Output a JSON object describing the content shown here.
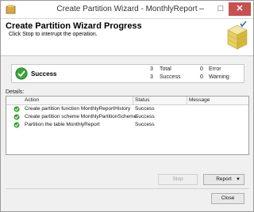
{
  "window": {
    "title": "Create Partition Wizard - MonthlyReport",
    "minimize": "–",
    "maximize": "□",
    "close": "✕"
  },
  "header": {
    "title": "Create Partition Wizard Progress",
    "subtitle": "Click Stop to interrupt the operation."
  },
  "summary": {
    "status": "Success",
    "total_count": "3",
    "total_label": "Total",
    "success_count": "3",
    "success_label": "Success",
    "error_count": "0",
    "error_label": "Error",
    "warning_count": "0",
    "warning_label": "Warning"
  },
  "details": {
    "label": "Details:",
    "columns": [
      "Action",
      "Status",
      "Message"
    ],
    "rows": [
      {
        "action": "Create partition function MonthlyReportHistory",
        "status": "Success",
        "message": ""
      },
      {
        "action": "Create partition scheme MonthlyPartitionScheme",
        "status": "Success",
        "message": ""
      },
      {
        "action": "Partition the table MonthlyReport",
        "status": "Success",
        "message": ""
      }
    ]
  },
  "buttons": {
    "stop": "Stop",
    "report": "Report",
    "report_arrow": "▼",
    "close": "Close"
  },
  "colors": {
    "success_green": "#3aa637",
    "close_red": "#c75050"
  },
  "icons": [
    "app-icon",
    "wizard-icon",
    "success-check-icon"
  ]
}
